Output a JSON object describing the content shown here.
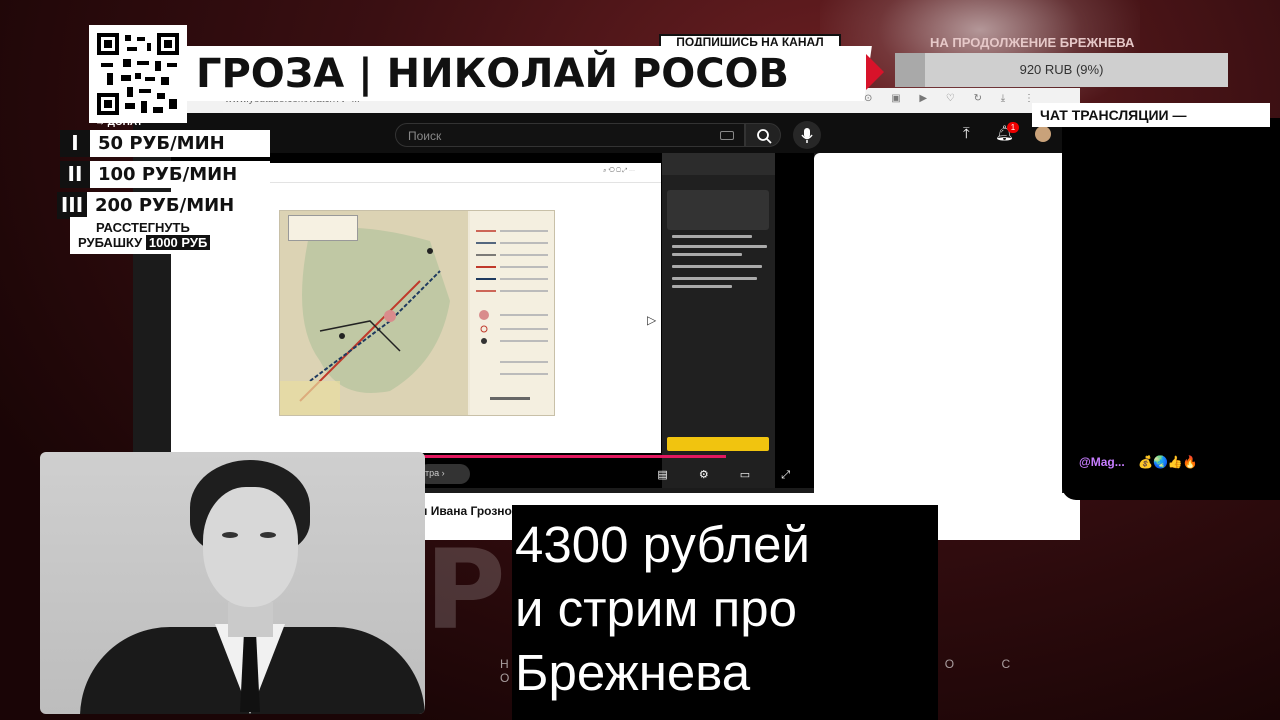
{
  "header": {
    "title": "ГРОЗА | НИКОЛАЙ РОСОВ",
    "subscribe_label": "ПОДПИШИСЬ НА КАНАЛ"
  },
  "donation": {
    "donate_label": "→ ДОНАТ",
    "tiers": [
      {
        "roman": "I",
        "price": "50 РУБ/МИН"
      },
      {
        "roman": "II",
        "price": "100 РУБ/МИН"
      },
      {
        "roman": "III",
        "price": "200 РУБ/МИН"
      }
    ],
    "shirt_line1": "РАССТЕГНУТЬ",
    "shirt_line2": "РУБАШКУ",
    "shirt_price": "1000 РУБ"
  },
  "goal": {
    "label": "НА ПРОДОЛЖЕНИЕ БРЕЖНЕВА",
    "amount": "920 RUB (9%)",
    "percent": 9
  },
  "stream_chat": {
    "header": "ЧАТ ТРАНСЛЯЦИИ —",
    "messages": [
      {
        "user": "@Mag...",
        "emoji": "💰🌏👍🔥"
      }
    ]
  },
  "screen": {
    "url": "www.youtube.com/watch?v=...",
    "search_placeholder": "Поиск",
    "notification_count": "1",
    "video_title_partial": "и Ивана Грозно"
  },
  "caption": {
    "lines": [
      "4300 рублей",
      "и стрим про",
      "Брежнева"
    ]
  },
  "background": {
    "brand_letters": "РОСОВ",
    "brand_sub": "Н И К О Л А Й   Р О С О В"
  },
  "colors": {
    "accent_red": "#d8132a",
    "progress_pink": "#e2185f",
    "username_purple": "#c77dff"
  }
}
